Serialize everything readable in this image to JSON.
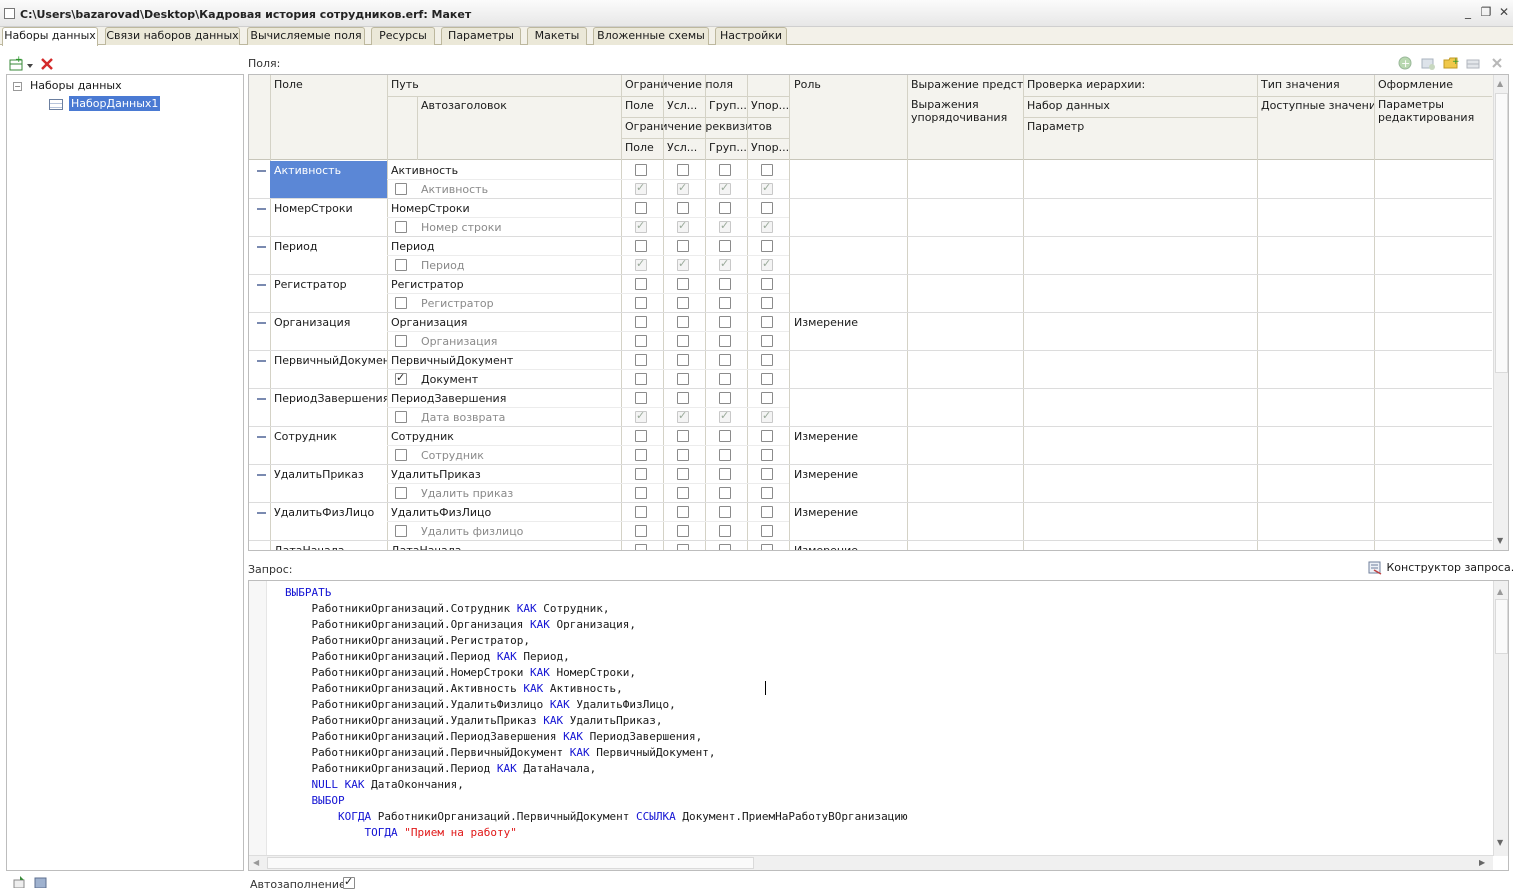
{
  "window": {
    "title": "C:\\Users\\bazarovad\\Desktop\\Кадровая история сотрудников.erf: Макет"
  },
  "tabs": [
    "Наборы данных",
    "Связи наборов данных",
    "Вычисляемые поля",
    "Ресурсы",
    "Параметры",
    "Макеты",
    "Вложенные схемы",
    "Настройки"
  ],
  "tree": {
    "root": "Наборы данных",
    "child": "НаборДанных1"
  },
  "fields_label": "Поля:",
  "query_label": "Запрос:",
  "query_builder": "Конструктор запроса...",
  "autofill_label": "Автозаполнение",
  "headers": {
    "field": "Поле",
    "path": "Путь",
    "autotitle": "Автозаголовок",
    "field_restriction": "Ограничение поля",
    "attr_restriction": "Ограничение реквизитов",
    "sub_field": "Поле",
    "sub_cond": "Усл...",
    "sub_group": "Груп...",
    "sub_order": "Упор...",
    "role": "Роль",
    "expr_present": "Выражение предст...",
    "expr_order": "Выражения упорядочивания",
    "hier_check": "Проверка иерархии:",
    "dataset": "Набор данных",
    "parameter": "Параметр",
    "value_type": "Тип значения",
    "avail_values": "Доступные значения",
    "format": "Оформление",
    "edit_params": "Параметры редактирования"
  },
  "rows": [
    {
      "field": "Активность",
      "path": "Активность",
      "title": "Активность",
      "title_checked": false,
      "role": "",
      "attr_grey": true,
      "selected": true
    },
    {
      "field": "НомерСтроки",
      "path": "НомерСтроки",
      "title": "Номер строки",
      "title_checked": false,
      "role": "",
      "attr_grey": true
    },
    {
      "field": "Период",
      "path": "Период",
      "title": "Период",
      "title_checked": false,
      "role": "",
      "attr_grey": true
    },
    {
      "field": "Регистратор",
      "path": "Регистратор",
      "title": "Регистратор",
      "title_checked": false,
      "role": "",
      "attr_grey": false
    },
    {
      "field": "Организация",
      "path": "Организация",
      "title": "Организация",
      "title_checked": false,
      "role": "Измерение",
      "attr_grey": false
    },
    {
      "field": "ПервичныйДокумент",
      "path": "ПервичныйДокумент",
      "title": "Документ",
      "title_checked": true,
      "role": "",
      "attr_grey": false
    },
    {
      "field": "ПериодЗавершения",
      "path": "ПериодЗавершения",
      "title": "Дата возврата",
      "title_checked": false,
      "role": "",
      "attr_grey": true
    },
    {
      "field": "Сотрудник",
      "path": "Сотрудник",
      "title": "Сотрудник",
      "title_checked": false,
      "role": "Измерение",
      "attr_grey": false
    },
    {
      "field": "УдалитьПриказ",
      "path": "УдалитьПриказ",
      "title": "Удалить приказ",
      "title_checked": false,
      "role": "Измерение",
      "attr_grey": false
    },
    {
      "field": "УдалитьФизЛицо",
      "path": "УдалитьФизЛицо",
      "title": "Удалить физлицо",
      "title_checked": false,
      "role": "Измерение",
      "attr_grey": false
    },
    {
      "field": "ДатаНачала",
      "path": "ДатаНачала",
      "title": "",
      "title_checked": false,
      "role": "Измерение",
      "attr_grey": false
    }
  ],
  "query_lines": [
    [
      [
        "kw",
        "ВЫБРАТЬ"
      ]
    ],
    [
      [
        "t",
        "    РаботникиОрганизаций.Сотрудник "
      ],
      [
        "kw",
        "КАК"
      ],
      [
        "t",
        " Сотрудник,"
      ]
    ],
    [
      [
        "t",
        "    РаботникиОрганизаций.Организация "
      ],
      [
        "kw",
        "КАК"
      ],
      [
        "t",
        " Организация,"
      ]
    ],
    [
      [
        "t",
        "    РаботникиОрганизаций.Регистратор,"
      ]
    ],
    [
      [
        "t",
        "    РаботникиОрганизаций.Период "
      ],
      [
        "kw",
        "КАК"
      ],
      [
        "t",
        " Период,"
      ]
    ],
    [
      [
        "t",
        "    РаботникиОрганизаций.НомерСтроки "
      ],
      [
        "kw",
        "КАК"
      ],
      [
        "t",
        " НомерСтроки,"
      ]
    ],
    [
      [
        "t",
        "    РаботникиОрганизаций.Активность "
      ],
      [
        "kw",
        "КАК"
      ],
      [
        "t",
        " Активность,"
      ]
    ],
    [
      [
        "t",
        "    РаботникиОрганизаций.УдалитьФизлицо "
      ],
      [
        "kw",
        "КАК"
      ],
      [
        "t",
        " УдалитьФизЛицо,"
      ]
    ],
    [
      [
        "t",
        "    РаботникиОрганизаций.УдалитьПриказ "
      ],
      [
        "kw",
        "КАК"
      ],
      [
        "t",
        " УдалитьПриказ,"
      ]
    ],
    [
      [
        "t",
        "    РаботникиОрганизаций.ПериодЗавершения "
      ],
      [
        "kw",
        "КАК"
      ],
      [
        "t",
        " ПериодЗавершения,"
      ]
    ],
    [
      [
        "t",
        "    РаботникиОрганизаций.ПервичныйДокумент "
      ],
      [
        "kw",
        "КАК"
      ],
      [
        "t",
        " ПервичныйДокумент,"
      ]
    ],
    [
      [
        "t",
        "    РаботникиОрганизаций.Период "
      ],
      [
        "kw",
        "КАК"
      ],
      [
        "t",
        " ДатаНачала,"
      ]
    ],
    [
      [
        "t",
        "    "
      ],
      [
        "kw",
        "NULL"
      ],
      [
        "t",
        " "
      ],
      [
        "kw",
        "КАК"
      ],
      [
        "t",
        " ДатаОкончания,"
      ]
    ],
    [
      [
        "t",
        "    "
      ],
      [
        "kw",
        "ВЫБОР"
      ]
    ],
    [
      [
        "t",
        "        "
      ],
      [
        "kw",
        "КОГДА"
      ],
      [
        "t",
        " РаботникиОрганизаций.ПервичныйДокумент "
      ],
      [
        "kw",
        "ССЫЛКА"
      ],
      [
        "t",
        " Документ.ПриемНаРаботуВОрганизацию"
      ]
    ],
    [
      [
        "t",
        "            "
      ],
      [
        "kw",
        "ТОГДА"
      ],
      [
        "t",
        " "
      ],
      [
        "str",
        "\"Прием на работу\""
      ]
    ]
  ]
}
